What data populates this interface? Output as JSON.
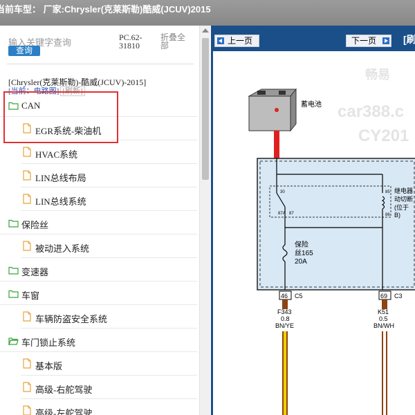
{
  "header": {
    "title": "当前车型： 厂家:Chrysler(克莱斯勒)酷威(JCUV)2015"
  },
  "search": {
    "placeholder": "输入关键字查询",
    "query_label": "查询"
  },
  "pc_code": "PC.62-31810",
  "collapse_all": "折叠全部",
  "model": "[Chrysler(克莱斯勒)-酷威(JCUV)-2015]",
  "current": {
    "label": "[当前：电路图]",
    "return": "[刷新]"
  },
  "tree": [
    {
      "level": 0,
      "label": "CAN",
      "icon": "folder-icon"
    },
    {
      "level": 1,
      "label": "EGR系统-柴油机",
      "icon": "document-icon"
    },
    {
      "level": 1,
      "label": "HVAC系统",
      "icon": "document-icon"
    },
    {
      "level": 1,
      "label": "LIN总线布局",
      "icon": "document-icon"
    },
    {
      "level": 1,
      "label": "LIN总线系统",
      "icon": "document-icon"
    },
    {
      "level": 0,
      "label": "保险丝",
      "icon": "folder-icon"
    },
    {
      "level": 1,
      "label": "被动进入系统",
      "icon": "document-icon"
    },
    {
      "level": 0,
      "label": "变速器",
      "icon": "folder-icon"
    },
    {
      "level": 0,
      "label": "车窗",
      "icon": "folder-icon"
    },
    {
      "level": 1,
      "label": "车辆防盗安全系统",
      "icon": "document-icon"
    },
    {
      "level": 0,
      "label": "车门锁止系统",
      "icon": "folder-open-icon"
    },
    {
      "level": 1,
      "label": "基本版",
      "icon": "document-icon"
    },
    {
      "level": 1,
      "label": "高级-右舵驾驶",
      "icon": "document-icon"
    },
    {
      "level": 1,
      "label": "高级-左舵驾驶",
      "icon": "document-icon"
    }
  ],
  "nav": {
    "prev": "上一页",
    "next": "下一页",
    "tab": "[刷"
  },
  "diagram": {
    "battery": "蓄电池",
    "relay_pins": {
      "p30": "30",
      "p87a": "87A",
      "p87": "87",
      "p85": "85",
      "p86": "86"
    },
    "relay_label": "继电器",
    "relay_sub1": "动切断",
    "relay_sub2": "(位于",
    "relay_sub3": "B)",
    "fuse_label1": "保险",
    "fuse_label2": "丝165",
    "fuse_amp": "20A",
    "conn1": {
      "pin": "46",
      "name": "C5"
    },
    "conn2": {
      "pin": "69",
      "name": "C3"
    },
    "wire1": {
      "code": "F343",
      "size": "0.8",
      "color": "BN/YE"
    },
    "wire2": {
      "code": "K51",
      "size": "0.5",
      "color": "BN/WH"
    },
    "watermark1": "畅易",
    "watermark2": "car388.c",
    "watermark3": "CY201"
  },
  "colors": {
    "accent": "#1a4f8a",
    "highlight": "#e03030",
    "folder": "#3aa33a",
    "doc": "#e8a23a"
  }
}
